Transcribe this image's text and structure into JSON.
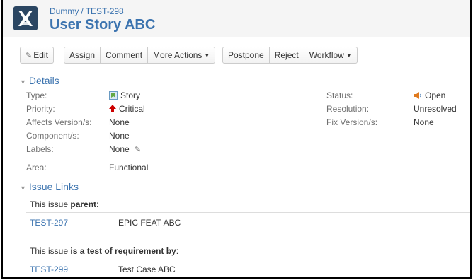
{
  "header": {
    "project": "Dummy",
    "separator": "/",
    "issue_key": "TEST-298",
    "title": "User Story ABC"
  },
  "toolbar": {
    "edit": "Edit",
    "assign": "Assign",
    "comment": "Comment",
    "more_actions": "More Actions",
    "postpone": "Postpone",
    "reject": "Reject",
    "workflow": "Workflow"
  },
  "details": {
    "heading": "Details",
    "type_label": "Type:",
    "type_value": "Story",
    "priority_label": "Priority:",
    "priority_value": "Critical",
    "affects_label": "Affects Version/s:",
    "affects_value": "None",
    "component_label": "Component/s:",
    "component_value": "None",
    "labels_label": "Labels:",
    "labels_value": "None",
    "status_label": "Status:",
    "status_value": "Open",
    "resolution_label": "Resolution:",
    "resolution_value": "Unresolved",
    "fix_label": "Fix Version/s:",
    "fix_value": "None",
    "area_label": "Area:",
    "area_value": "Functional"
  },
  "issue_links": {
    "heading": "Issue Links",
    "parent_prefix": "This issue ",
    "parent_relation": "parent",
    "parent_suffix": ":",
    "parent_key": "TEST-297",
    "parent_summary": "EPIC FEAT ABC",
    "test_prefix": "This issue ",
    "test_relation": "is a test of requirement by",
    "test_suffix": ":",
    "test_key": "TEST-299",
    "test_summary": "Test Case ABC"
  },
  "colors": {
    "link": "#3b73af",
    "header_bg": "#f5f5f5",
    "priority_critical": "#cc0000",
    "status_open": "#e07a1e"
  }
}
